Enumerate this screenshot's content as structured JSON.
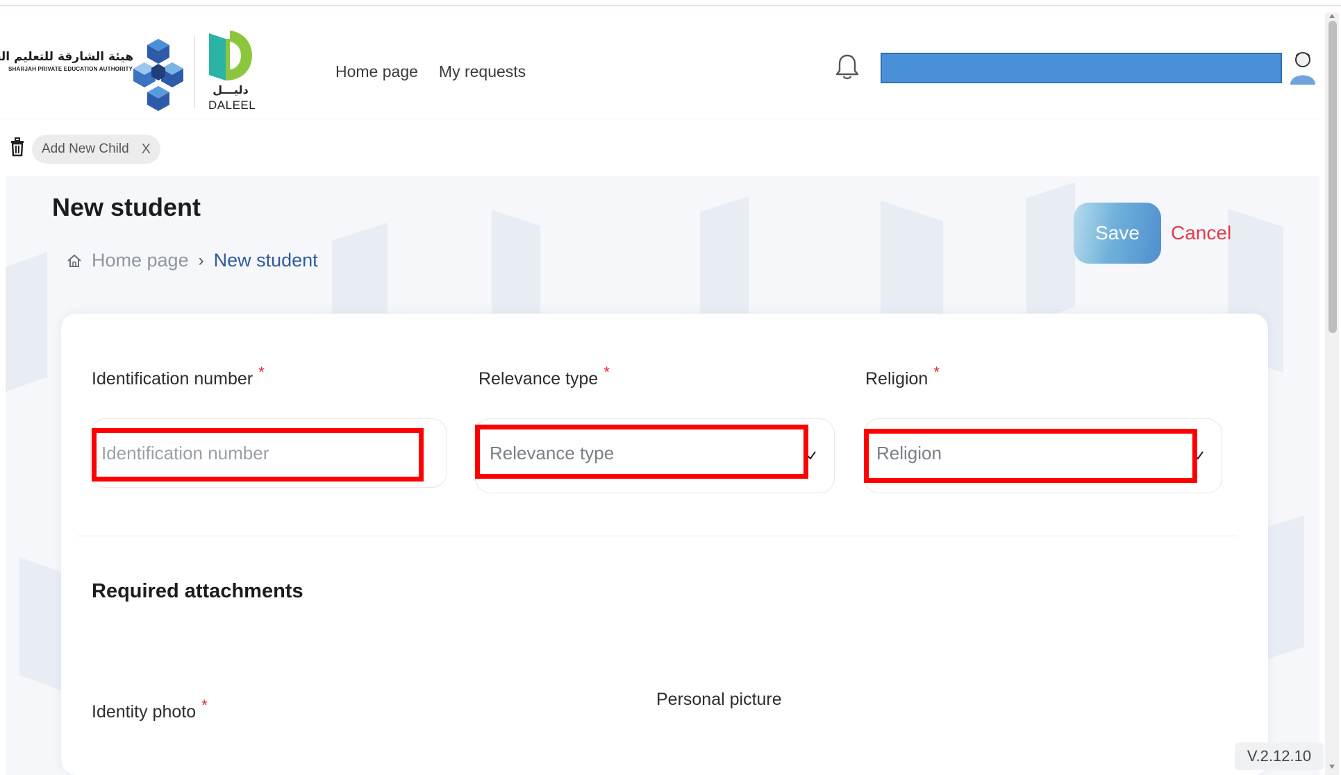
{
  "brand": {
    "authority_arabic": "هيئة الشارقة للتعليم الخاص",
    "authority_english": "SHARJAH PRIVATE EDUCATION AUTHORITY",
    "daleel_arabic": "دليـــل",
    "daleel_latin": "DALEEL"
  },
  "nav": {
    "home": "Home page",
    "requests": "My requests"
  },
  "chip": {
    "label": "Add New Child",
    "close": "X"
  },
  "page": {
    "title": "New student",
    "breadcrumb_home": "Home page",
    "breadcrumb_sep": "›",
    "breadcrumb_current": "New student"
  },
  "actions": {
    "save": "Save",
    "cancel": "Cancel"
  },
  "form": {
    "required_mark": "*",
    "identification": {
      "label": "Identification number",
      "placeholder": "Identification number"
    },
    "relevance": {
      "label": "Relevance type",
      "value": "Relevance type"
    },
    "religion": {
      "label": "Religion",
      "value": "Religion"
    }
  },
  "attachments": {
    "title": "Required attachments",
    "identity_photo": "Identity photo",
    "personal_picture": "Personal picture"
  },
  "version": "V.2.12.10",
  "colors": {
    "highlight": "#ff0000",
    "user_bar": "#4a90d9",
    "cancel": "#e13a4a",
    "breadcrumb_current": "#2f5aa0",
    "daleel_green": "#8cc63f",
    "daleel_teal": "#2bb3a6",
    "spea_blue": "#2e5ba8"
  },
  "icons": {
    "bell": "bell-icon",
    "avatar": "user-avatar-icon",
    "trash": "trash-icon",
    "home": "home-icon",
    "chevron": "chevron-down-icon"
  }
}
